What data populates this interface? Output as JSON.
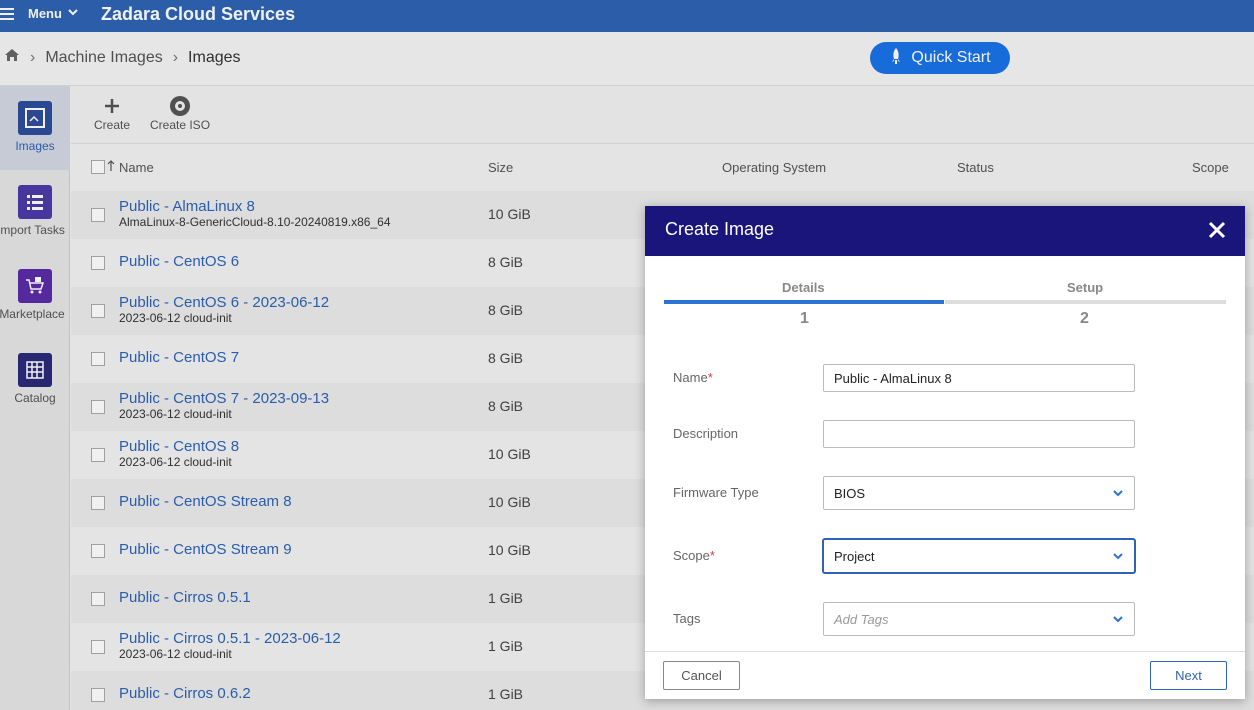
{
  "topbar": {
    "menu_label": "Menu",
    "brand": "Zadara Cloud Services"
  },
  "breadcrumb": {
    "items": [
      "Machine Images",
      "Images"
    ]
  },
  "quick_start": {
    "label": "Quick Start"
  },
  "sidebar": {
    "items": [
      {
        "label": "Images",
        "icon": "image-icon",
        "active": true
      },
      {
        "label": "Import Tasks",
        "icon": "list-icon"
      },
      {
        "label": "Marketplace",
        "icon": "cart-icon"
      },
      {
        "label": "Catalog",
        "icon": "grid-icon"
      }
    ]
  },
  "toolbar": {
    "create_label": "Create",
    "create_iso_label": "Create ISO"
  },
  "table": {
    "headers": {
      "name": "Name",
      "size": "Size",
      "os": "Operating System",
      "status": "Status",
      "scope": "Scope"
    },
    "rows": [
      {
        "name": "Public - AlmaLinux 8",
        "sub": "AlmaLinux-8-GenericCloud-8.10-20240819.x86_64",
        "size": "10 GiB"
      },
      {
        "name": "Public - CentOS 6",
        "sub": "",
        "size": "8 GiB"
      },
      {
        "name": "Public - CentOS 6 - 2023-06-12",
        "sub": "2023-06-12 cloud-init",
        "size": "8 GiB"
      },
      {
        "name": "Public - CentOS 7",
        "sub": "",
        "size": "8 GiB"
      },
      {
        "name": "Public - CentOS 7 - 2023-09-13",
        "sub": "2023-06-12 cloud-init",
        "size": "8 GiB"
      },
      {
        "name": "Public - CentOS 8",
        "sub": "2023-06-12 cloud-init",
        "size": "10 GiB"
      },
      {
        "name": "Public - CentOS Stream 8",
        "sub": "",
        "size": "10 GiB"
      },
      {
        "name": "Public - CentOS Stream 9",
        "sub": "",
        "size": "10 GiB"
      },
      {
        "name": "Public - Cirros 0.5.1",
        "sub": "",
        "size": "1 GiB"
      },
      {
        "name": "Public - Cirros 0.5.1 - 2023-06-12",
        "sub": "2023-06-12 cloud-init",
        "size": "1 GiB"
      },
      {
        "name": "Public - Cirros 0.6.2",
        "sub": "",
        "size": "1 GiB"
      }
    ]
  },
  "modal": {
    "title": "Create Image",
    "steps": [
      {
        "label": "Details",
        "number": "1",
        "active": true
      },
      {
        "label": "Setup",
        "number": "2",
        "active": false
      }
    ],
    "fields": {
      "name": {
        "label": "Name",
        "required": "*",
        "value": "Public - AlmaLinux 8"
      },
      "description": {
        "label": "Description",
        "value": ""
      },
      "firmware": {
        "label": "Firmware Type",
        "value": "BIOS"
      },
      "scope": {
        "label": "Scope",
        "required": "*",
        "value": "Project"
      },
      "tags": {
        "label": "Tags",
        "placeholder": "Add Tags"
      }
    },
    "cancel_label": "Cancel",
    "next_label": "Next"
  },
  "colors": {
    "topbar": "#2f63b4",
    "modal_header": "#19157a",
    "link": "#2e63b5",
    "accent": "#1a73e8"
  }
}
